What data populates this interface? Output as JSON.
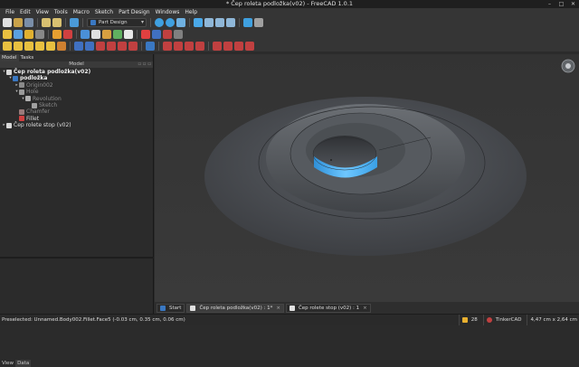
{
  "window": {
    "title": "* Čep roleta podložka(v02) - FreeCAD 1.0.1",
    "minimize": "–",
    "maximize": "□",
    "close": "✕"
  },
  "menu": [
    "File",
    "Edit",
    "View",
    "Tools",
    "Macro",
    "Sketch",
    "Part Design",
    "Windows",
    "Help"
  ],
  "toolbar": {
    "workbench": "Part Design"
  },
  "panel": {
    "tabs": [
      "Model",
      "Tasks"
    ],
    "header": "Model",
    "tree": [
      {
        "label": "Čep roleta podložka(v02)",
        "level": 0,
        "arrow": "▾",
        "bold": true,
        "icon": "document-icon"
      },
      {
        "label": "podložka",
        "level": 1,
        "arrow": "▾",
        "bold": true,
        "icon": "body-icon"
      },
      {
        "label": "Origin002",
        "level": 2,
        "arrow": "▸",
        "dim": true,
        "icon": "origin-icon"
      },
      {
        "label": "Hole",
        "level": 2,
        "arrow": "▾",
        "dim": true,
        "icon": "hole-icon"
      },
      {
        "label": "Revolution",
        "level": 3,
        "arrow": "▾",
        "dim": true,
        "icon": "revolution-icon"
      },
      {
        "label": "Sketch",
        "level": 4,
        "arrow": "",
        "dim": true,
        "icon": "sketch-icon"
      },
      {
        "label": "Chamfer",
        "level": 2,
        "arrow": "",
        "dim": true,
        "icon": "chamfer-icon"
      },
      {
        "label": "Fillet",
        "level": 2,
        "arrow": "",
        "icon": "fillet-icon"
      },
      {
        "label": "Čep rolete stop (v02)",
        "level": 0,
        "arrow": "▸",
        "icon": "document-icon"
      }
    ],
    "bottom_tabs": [
      "View",
      "Data"
    ]
  },
  "doc_tabs": [
    {
      "label": "Start",
      "active": false
    },
    {
      "label": "Čep roleta podložka(v02) : 1*",
      "active": true
    },
    {
      "label": "Čep rolete stop (v02) : 1",
      "active": false
    }
  ],
  "status": {
    "preselected": "Preselected: Unnamed.Body002.Fillet.Face5 (-0.03 cm, 0.35 cm, 0.06 cm)",
    "counter": "28",
    "nav_style": "TinkerCAD",
    "dimensions": "4,47 cm x 2,64 cm"
  },
  "colors": {
    "accent": "#3a78c2",
    "face_highlight": "#3ea8ee",
    "background": "#2b2b2b"
  }
}
